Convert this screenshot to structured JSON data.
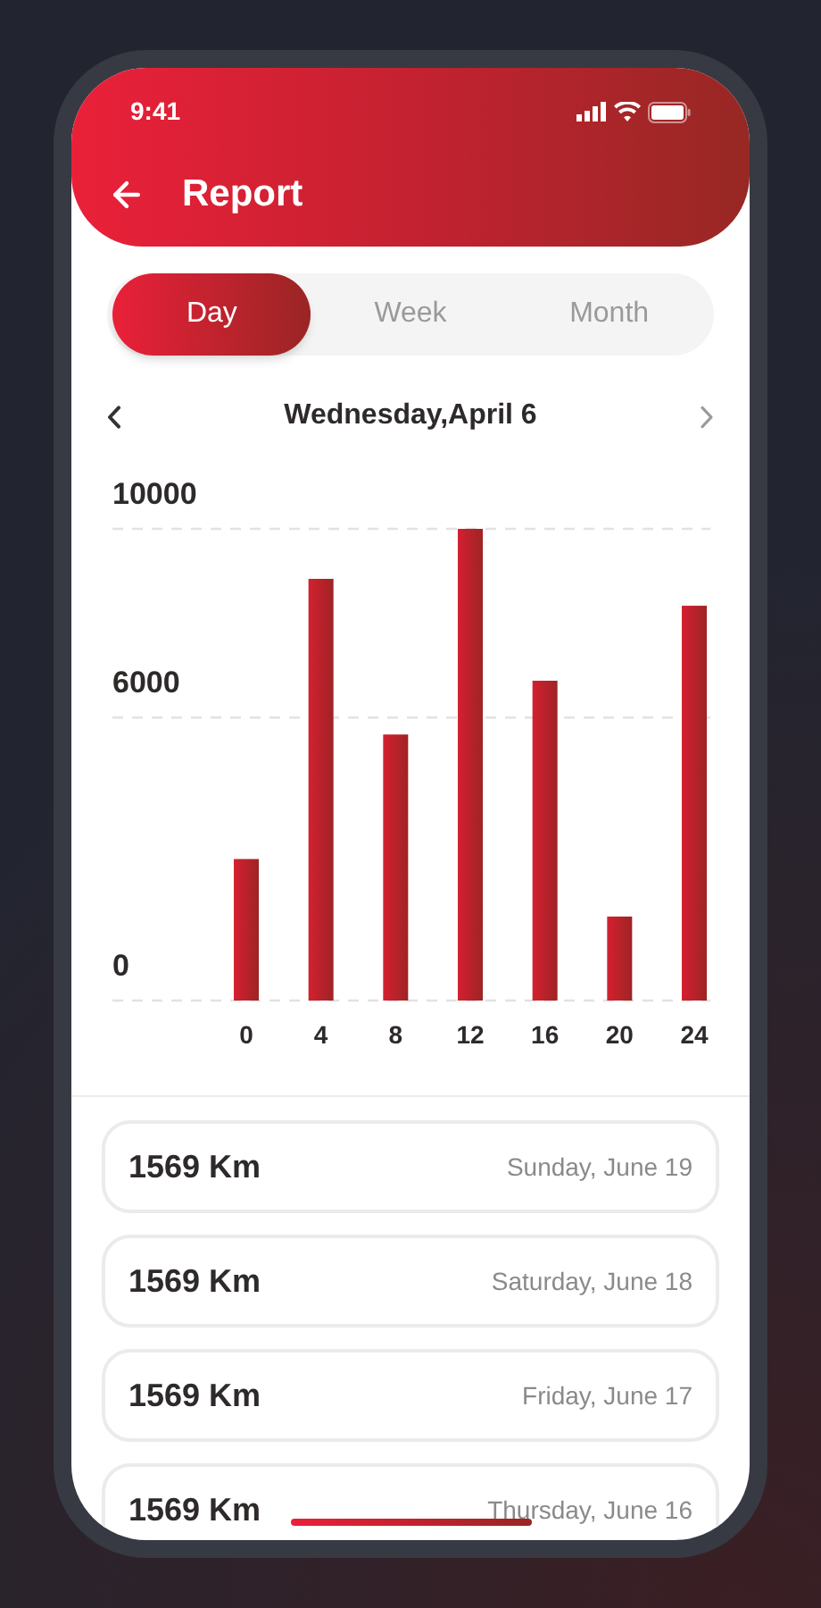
{
  "status_bar": {
    "time": "9:41"
  },
  "header": {
    "title": "Report"
  },
  "tabs": [
    {
      "label": "Day",
      "selected": true
    },
    {
      "label": "Week",
      "selected": false
    },
    {
      "label": "Month",
      "selected": false
    }
  ],
  "date_nav": {
    "label": "Wednesday,April 6"
  },
  "chart_data": {
    "type": "bar",
    "categories": [
      "0",
      "4",
      "8",
      "12",
      "16",
      "20",
      "24"
    ],
    "series": [
      {
        "color": "#d42030",
        "values": [
          3000,
          8940,
          5640,
          10000,
          6780,
          1780,
          8370
        ]
      }
    ],
    "ylim": [
      0,
      10000
    ],
    "yticks": [
      0,
      6000,
      10000
    ]
  },
  "trips": [
    {
      "distance": "1569 Km",
      "date": "Sunday, June 19"
    },
    {
      "distance": "1569 Km",
      "date": "Saturday, June 18"
    },
    {
      "distance": "1569 Km",
      "date": "Friday, June 17"
    },
    {
      "distance": "1569 Km",
      "date": "Thursday, June 16"
    }
  ]
}
